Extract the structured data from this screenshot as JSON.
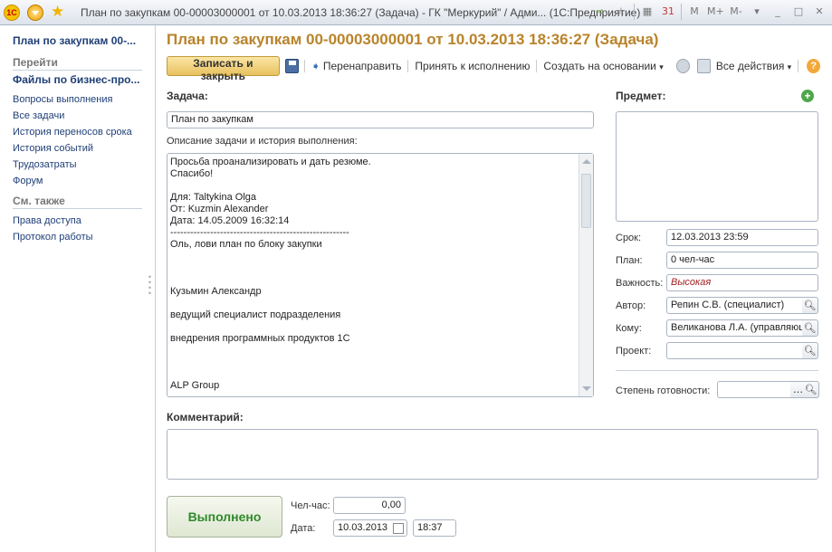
{
  "window": {
    "title": "План по закупкам 00-00003000001 от 10.03.2013 18:36:27 (Задача) - ГК \"Меркурий\" / Адми... (1С:Предприятие)",
    "logo": "1С",
    "right_icons": [
      "M",
      "M+",
      "M-"
    ]
  },
  "sidebar": {
    "title": "План по закупкам 00-...",
    "goto_header": "Перейти",
    "active_item": "Файлы по бизнес-про...",
    "links": [
      "Вопросы выполнения",
      "Все задачи",
      "История переносов срока",
      "История событий",
      "Трудозатраты",
      "Форум"
    ],
    "see_also_header": "См. также",
    "see_also_links": [
      "Права доступа",
      "Протокол работы"
    ]
  },
  "document": {
    "title": "План по закупкам 00-00003000001 от 10.03.2013 18:36:27 (Задача)"
  },
  "toolbar": {
    "save_close": "Записать и закрыть",
    "forward": "Перенаправить",
    "accept": "Принять к исполнению",
    "create_based": "Создать на основании",
    "all_actions": "Все действия",
    "help": "?"
  },
  "task": {
    "label": "Задача:",
    "value": "План по закупкам",
    "desc_label": "Описание задачи и история выполнения:",
    "description": "Просьба проанализировать и дать резюме.\nСпасибо!\n\nДля: Taltykina Olga\nОт: Kuzmin Alexander\nДата: 14.05.2009 16:32:14\n------------------------------------------------------\nОль, лови план по блоку закупки\n\n\n\nКузьмин Александр\n\nведущий специалист подразделения\n\nвнедрения программных продуктов 1С\n\n\n\nALP Group"
  },
  "subject": {
    "label": "Предмет:"
  },
  "props": {
    "deadline_label": "Срок:",
    "deadline": "12.03.2013 23:59",
    "plan_label": "План:",
    "plan": "0 чел-час",
    "importance_label": "Важность:",
    "importance": "Высокая",
    "author_label": "Автор:",
    "author": "Репин С.В. (специалист)",
    "to_label": "Кому:",
    "to": "Великанова Л.А. (управляющ",
    "project_label": "Проект:",
    "project": "",
    "readiness_label": "Степень готовности:",
    "readiness": ""
  },
  "comment": {
    "label": "Комментарий:",
    "value": ""
  },
  "footer": {
    "done_button": "Выполнено",
    "manhours_label": "Чел-час:",
    "manhours": "0,00",
    "date_label": "Дата:",
    "date": "10.03.2013",
    "time": "18:37"
  }
}
